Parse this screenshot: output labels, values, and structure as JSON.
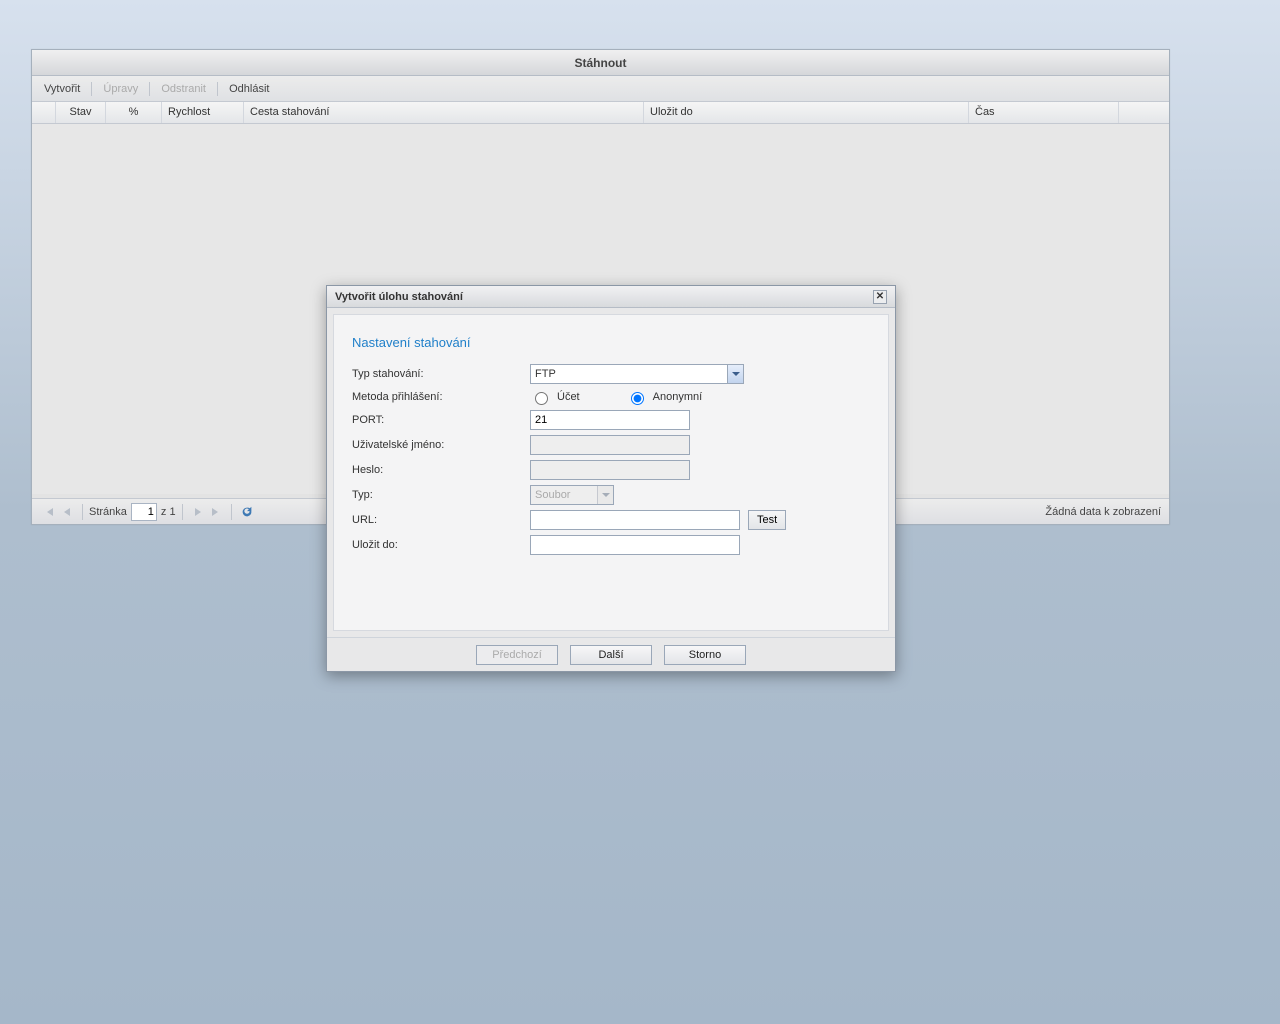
{
  "panel": {
    "title": "Stáhnout",
    "toolbar": {
      "create": "Vytvořit",
      "edit": "Úpravy",
      "delete": "Odstranit",
      "logout": "Odhlásit"
    },
    "columns": {
      "status": "Stav",
      "percent": "%",
      "speed": "Rychlost",
      "path": "Cesta stahování",
      "saveTo": "Uložit do",
      "time": "Čas"
    },
    "pager": {
      "label": "Stránka",
      "current": "1",
      "of": "z 1",
      "emptyMsg": "Žádná data k zobrazení"
    }
  },
  "dialog": {
    "title": "Vytvořit úlohu stahování",
    "section": "Nastavení stahování",
    "labels": {
      "type": "Typ stahování:",
      "login": "Metoda přihlášení:",
      "account": "Účet",
      "anonymous": "Anonymní",
      "port": "PORT:",
      "username": "Uživatelské jméno:",
      "password": "Heslo:",
      "fileType": "Typ:",
      "url": "URL:",
      "saveTo": "Uložit do:"
    },
    "values": {
      "typeSelected": "FTP",
      "fileTypeSelected": "Soubor",
      "port": "21",
      "loginMethod": "anonymous"
    },
    "buttons": {
      "test": "Test",
      "prev": "Předchozí",
      "next": "Další",
      "cancel": "Storno"
    }
  }
}
